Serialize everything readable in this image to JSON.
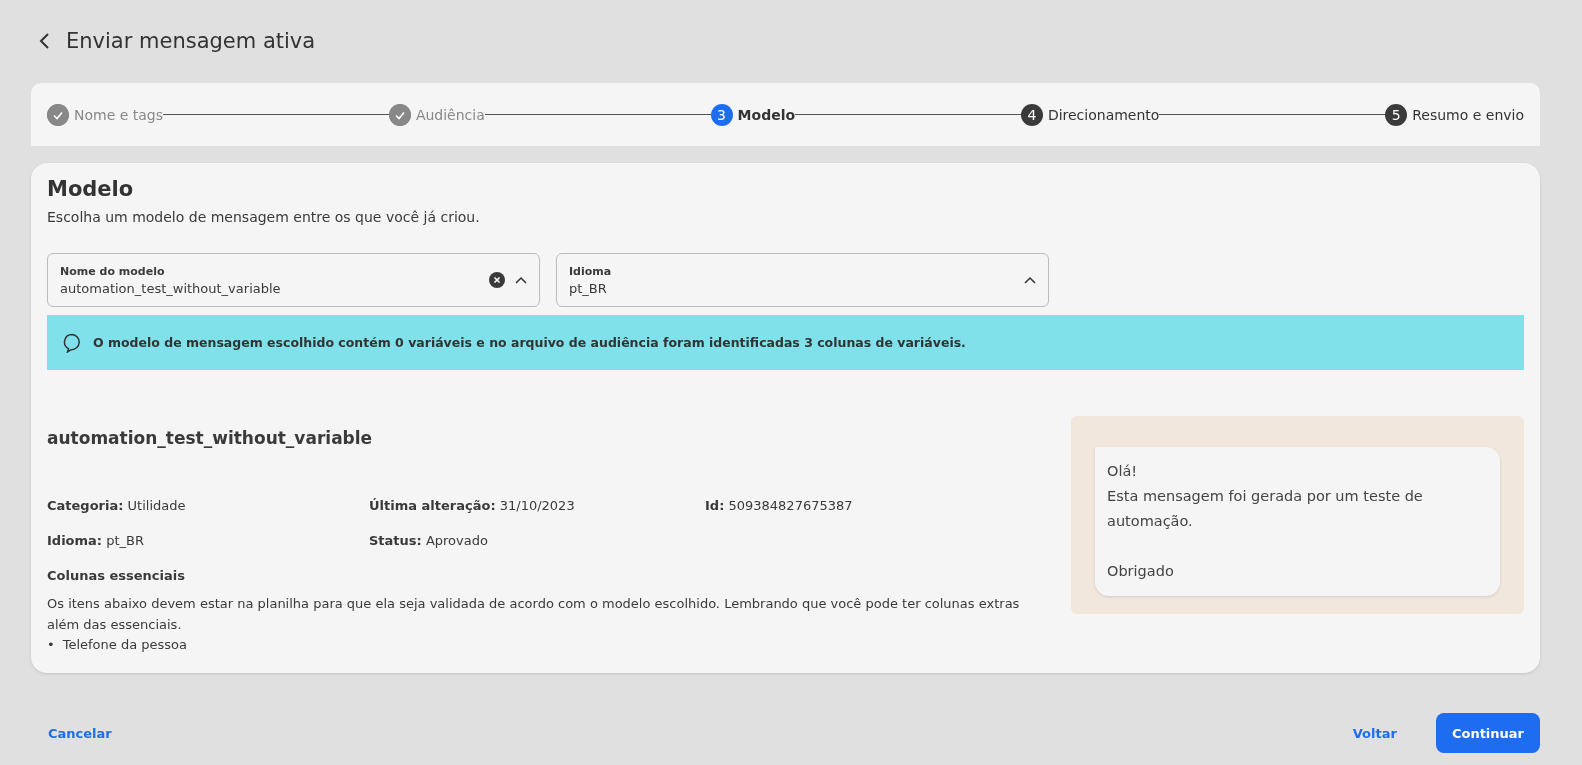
{
  "header": {
    "title": "Enviar mensagem ativa"
  },
  "steps": [
    {
      "label": "Nome e tags",
      "completed": true,
      "selected": false
    },
    {
      "label": "Audiência",
      "completed": true,
      "selected": false
    },
    {
      "label": "Modelo",
      "number": "3",
      "completed": false,
      "selected": true
    },
    {
      "label": "Direcionamento",
      "number": "4",
      "completed": false,
      "selected": false
    },
    {
      "label": "Resumo e envio",
      "number": "5",
      "completed": false,
      "selected": false
    }
  ],
  "section": {
    "title": "Modelo",
    "subtitle": "Escolha um modelo de mensagem entre os que você já criou."
  },
  "fields": [
    {
      "label": "Nome do modelo",
      "value": "automation_test_without_variable",
      "clearable": true
    },
    {
      "label": "Idioma",
      "value": "pt_BR",
      "clearable": false
    }
  ],
  "alert": {
    "text": "O modelo de mensagem escolhido contém 0 variáveis e no arquivo de audiência foram identificadas 3 colunas de variáveis."
  },
  "template": {
    "name": "automation_test_without_variable",
    "details": [
      "**Categoria:** Utilidade",
      "**Última alteração:** 31/10/2023",
      "**Id:** 509384827675387",
      "**Idioma:** pt_BR",
      "**Status:** Aprovado"
    ],
    "essentials_title": "Colunas essenciais",
    "essentials_text": "Os itens abaixo devem estar na planilha para que ela seja validada de acordo com o modelo escolhido. Lembrando que você pode ter colunas extras além das essenciais.",
    "essentials_items": [
      {
        "bullet": "•",
        "text": "Telefone da pessoa"
      }
    ],
    "preview_message": "Olá!\nEsta mensagem foi gerada por um teste de automação.\n\nObrigado"
  },
  "footer": {
    "cancel": "Cancelar",
    "back": "Voltar",
    "continue": "Continuar"
  }
}
